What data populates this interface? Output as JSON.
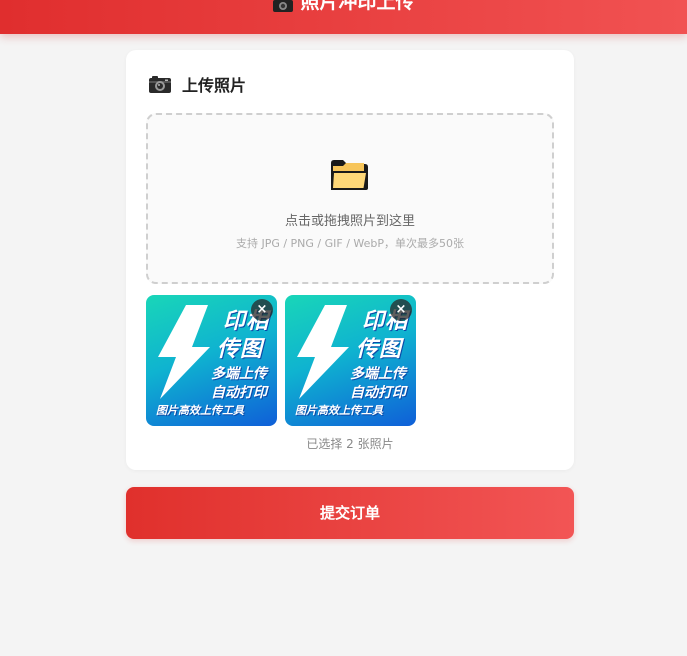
{
  "header": {
    "title": "照片冲印上传",
    "icon": "camera-icon"
  },
  "upload_card": {
    "title": "上传照片",
    "icon": "camera-icon",
    "dropzone": {
      "icon": "folder-icon",
      "main_text": "点击或拖拽照片到这里",
      "sub_text": "支持 JPG / PNG / GIF / WebP，单次最多50张"
    },
    "thumbnails": [
      {
        "lines": [
          "印相",
          "传图",
          "多端上传",
          "自动打印",
          "图片高效上传工具"
        ],
        "remove_label": "×"
      },
      {
        "lines": [
          "印相",
          "传图",
          "多端上传",
          "自动打印",
          "图片高效上传工具"
        ],
        "remove_label": "×"
      }
    ],
    "selected_text": "已选择 2 张照片"
  },
  "submit_label": "提交订单",
  "colors": {
    "accent": "#e53935",
    "accent_light": "#f15252",
    "thumb_teal": "#19d6b8",
    "thumb_blue": "#0f5fd8"
  }
}
